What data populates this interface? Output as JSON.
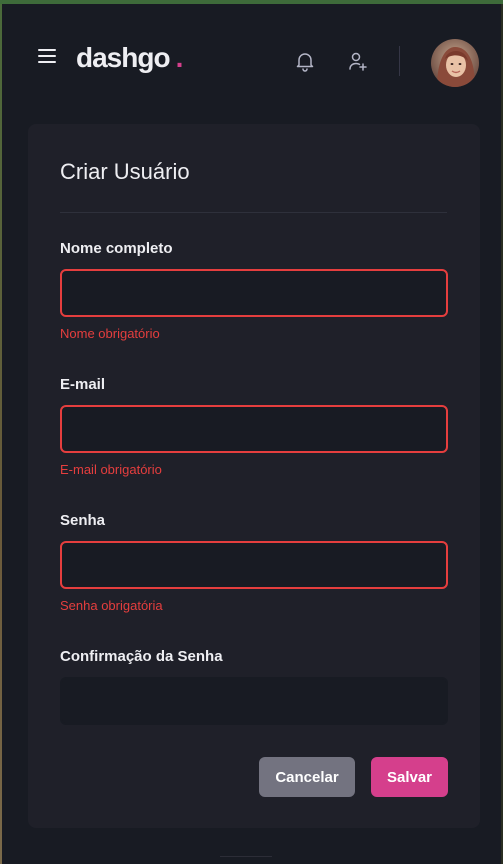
{
  "app": {
    "logo_text": "dashgo",
    "logo_dot": ".",
    "accent_color": "#D53F8C",
    "error_color": "#E53E3E"
  },
  "header": {
    "menu_icon": "menu-icon",
    "notifications_icon": "bell-icon",
    "add_user_icon": "user-plus-icon",
    "avatar_icon": "avatar"
  },
  "form": {
    "title": "Criar Usuário",
    "fields": [
      {
        "label": "Nome completo",
        "value": "",
        "error": "Nome obrigatório"
      },
      {
        "label": "E-mail",
        "value": "",
        "error": "E-mail obrigatório"
      },
      {
        "label": "Senha",
        "value": "",
        "error": "Senha obrigatória"
      },
      {
        "label": "Confirmação da Senha",
        "value": "",
        "error": ""
      }
    ],
    "cancel_label": "Cancelar",
    "save_label": "Salvar"
  }
}
